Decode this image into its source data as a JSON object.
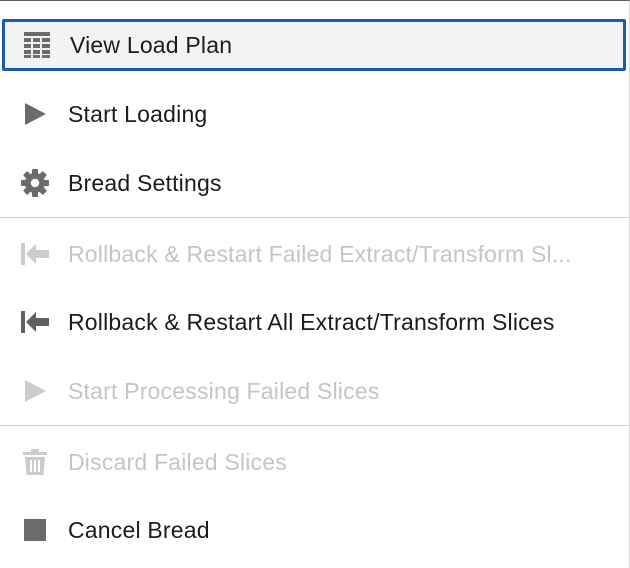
{
  "menu": {
    "items": [
      {
        "label": "View Load Plan",
        "icon": "grid-table-icon",
        "state": "focused"
      },
      {
        "label": "Start Loading",
        "icon": "play-icon",
        "state": "enabled"
      },
      {
        "label": "Bread Settings",
        "icon": "gear-icon",
        "state": "enabled"
      },
      {
        "label": "Rollback & Restart Failed Extract/Transform Sl...",
        "icon": "rollback-icon",
        "state": "disabled"
      },
      {
        "label": "Rollback & Restart All Extract/Transform Slices",
        "icon": "rollback-icon",
        "state": "enabled"
      },
      {
        "label": "Start Processing Failed Slices",
        "icon": "play-icon",
        "state": "disabled"
      },
      {
        "label": "Discard Failed Slices",
        "icon": "trash-icon",
        "state": "disabled"
      },
      {
        "label": "Cancel Bread",
        "icon": "stop-icon",
        "state": "enabled"
      }
    ]
  },
  "colors": {
    "focus_border": "#1c5bb4",
    "focus_background": "#f3f3f3",
    "icon_enabled": "#6b6b6b",
    "icon_disabled": "#cccccc",
    "text_enabled": "#1b1b1b",
    "text_disabled": "#c5c5c5"
  }
}
